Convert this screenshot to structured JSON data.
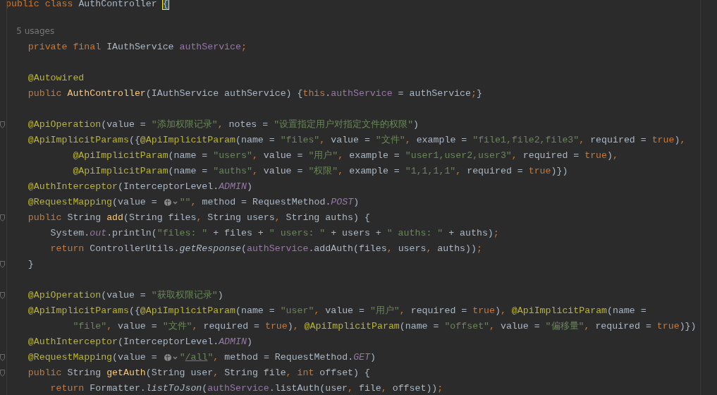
{
  "editor": {
    "lines": [
      {
        "kind": "code",
        "fold": false,
        "tokens": [
          {
            "t": "public ",
            "kind": "kw"
          },
          {
            "t": "class ",
            "kind": "kw"
          },
          {
            "t": "AuthController ",
            "kind": "plain"
          },
          {
            "t": "{",
            "kind": "match"
          }
        ]
      },
      {
        "kind": "blank",
        "fold": false
      },
      {
        "kind": "hint",
        "fold": false,
        "tokens": [
          {
            "t": "    5 usages",
            "kind": "hint"
          }
        ]
      },
      {
        "kind": "code",
        "fold": false,
        "tokens": [
          {
            "t": "    private final ",
            "kind": "kw"
          },
          {
            "t": "IAuthService ",
            "kind": "plain"
          },
          {
            "t": "authService",
            "kind": "field"
          },
          {
            "t": ";",
            "kind": "kw"
          }
        ]
      },
      {
        "kind": "blank",
        "fold": false
      },
      {
        "kind": "code",
        "fold": false,
        "tokens": [
          {
            "t": "    @Autowired",
            "kind": "ann"
          }
        ]
      },
      {
        "kind": "code",
        "fold": false,
        "tokens": [
          {
            "t": "    public ",
            "kind": "kw"
          },
          {
            "t": "AuthController",
            "kind": "method"
          },
          {
            "t": "(IAuthService authService) {",
            "kind": "plain"
          },
          {
            "t": "this",
            "kind": "kw"
          },
          {
            "t": ".",
            "kind": "plain"
          },
          {
            "t": "authService",
            "kind": "field"
          },
          {
            "t": " = authService",
            "kind": "plain"
          },
          {
            "t": ";",
            "kind": "kw"
          },
          {
            "t": "}",
            "kind": "plain"
          }
        ]
      },
      {
        "kind": "blank",
        "fold": false
      },
      {
        "kind": "code",
        "fold": true,
        "tokens": [
          {
            "t": "    @ApiOperation",
            "kind": "ann"
          },
          {
            "t": "(value = ",
            "kind": "plain"
          },
          {
            "t": "\"添加权限记录\"",
            "kind": "str"
          },
          {
            "t": ", ",
            "kind": "kw"
          },
          {
            "t": "notes = ",
            "kind": "plain"
          },
          {
            "t": "\"设置指定用户对指定文件的权限\"",
            "kind": "str"
          },
          {
            "t": ")",
            "kind": "plain"
          }
        ]
      },
      {
        "kind": "code",
        "fold": false,
        "tokens": [
          {
            "t": "    @ApiImplicitParams",
            "kind": "ann"
          },
          {
            "t": "({",
            "kind": "plain"
          },
          {
            "t": "@ApiImplicitParam",
            "kind": "ann"
          },
          {
            "t": "(name = ",
            "kind": "plain"
          },
          {
            "t": "\"files\"",
            "kind": "str"
          },
          {
            "t": ", ",
            "kind": "kw"
          },
          {
            "t": "value = ",
            "kind": "plain"
          },
          {
            "t": "\"文件\"",
            "kind": "str"
          },
          {
            "t": ", ",
            "kind": "kw"
          },
          {
            "t": "example = ",
            "kind": "plain"
          },
          {
            "t": "\"file1,file2,file3\"",
            "kind": "str"
          },
          {
            "t": ", ",
            "kind": "kw"
          },
          {
            "t": "required = ",
            "kind": "plain"
          },
          {
            "t": "true",
            "kind": "kw"
          },
          {
            "t": ")",
            "kind": "plain"
          },
          {
            "t": ",",
            "kind": "kw"
          }
        ]
      },
      {
        "kind": "code",
        "fold": false,
        "tokens": [
          {
            "t": "            @ApiImplicitParam",
            "kind": "ann"
          },
          {
            "t": "(name = ",
            "kind": "plain"
          },
          {
            "t": "\"users\"",
            "kind": "str"
          },
          {
            "t": ", ",
            "kind": "kw"
          },
          {
            "t": "value = ",
            "kind": "plain"
          },
          {
            "t": "\"用户\"",
            "kind": "str"
          },
          {
            "t": ", ",
            "kind": "kw"
          },
          {
            "t": "example = ",
            "kind": "plain"
          },
          {
            "t": "\"user1,user2,user3\"",
            "kind": "str"
          },
          {
            "t": ", ",
            "kind": "kw"
          },
          {
            "t": "required = ",
            "kind": "plain"
          },
          {
            "t": "true",
            "kind": "kw"
          },
          {
            "t": ")",
            "kind": "plain"
          },
          {
            "t": ",",
            "kind": "kw"
          }
        ]
      },
      {
        "kind": "code",
        "fold": false,
        "tokens": [
          {
            "t": "            @ApiImplicitParam",
            "kind": "ann"
          },
          {
            "t": "(name = ",
            "kind": "plain"
          },
          {
            "t": "\"auths\"",
            "kind": "str"
          },
          {
            "t": ", ",
            "kind": "kw"
          },
          {
            "t": "value = ",
            "kind": "plain"
          },
          {
            "t": "\"权限\"",
            "kind": "str"
          },
          {
            "t": ", ",
            "kind": "kw"
          },
          {
            "t": "example = ",
            "kind": "plain"
          },
          {
            "t": "\"1,1,1,1\"",
            "kind": "str"
          },
          {
            "t": ", ",
            "kind": "kw"
          },
          {
            "t": "required = ",
            "kind": "plain"
          },
          {
            "t": "true",
            "kind": "kw"
          },
          {
            "t": ")})",
            "kind": "plain"
          }
        ]
      },
      {
        "kind": "code",
        "fold": false,
        "tokens": [
          {
            "t": "    @AuthInterceptor",
            "kind": "ann"
          },
          {
            "t": "(InterceptorLevel.",
            "kind": "plain"
          },
          {
            "t": "ADMIN",
            "kind": "static"
          },
          {
            "t": ")",
            "kind": "plain"
          }
        ]
      },
      {
        "kind": "code",
        "fold": false,
        "tokens": [
          {
            "t": "    @RequestMapping",
            "kind": "ann"
          },
          {
            "t": "(value = ",
            "kind": "plain"
          },
          {
            "kind": "globe"
          },
          {
            "t": "\"\"",
            "kind": "str"
          },
          {
            "t": ", ",
            "kind": "kw"
          },
          {
            "t": "method = RequestMethod.",
            "kind": "plain"
          },
          {
            "t": "POST",
            "kind": "static"
          },
          {
            "t": ")",
            "kind": "plain"
          }
        ]
      },
      {
        "kind": "code",
        "fold": true,
        "tokens": [
          {
            "t": "    public ",
            "kind": "kw"
          },
          {
            "t": "String ",
            "kind": "plain"
          },
          {
            "t": "add",
            "kind": "method"
          },
          {
            "t": "(String files",
            "kind": "plain"
          },
          {
            "t": ", ",
            "kind": "kw"
          },
          {
            "t": "String users",
            "kind": "plain"
          },
          {
            "t": ", ",
            "kind": "kw"
          },
          {
            "t": "String auths) {",
            "kind": "plain"
          }
        ]
      },
      {
        "kind": "code",
        "fold": false,
        "tokens": [
          {
            "t": "        System.",
            "kind": "plain"
          },
          {
            "t": "out",
            "kind": "static"
          },
          {
            "t": ".println(",
            "kind": "plain"
          },
          {
            "t": "\"files: \"",
            "kind": "str"
          },
          {
            "t": " + files + ",
            "kind": "plain"
          },
          {
            "t": "\" users: \"",
            "kind": "str"
          },
          {
            "t": " + users + ",
            "kind": "plain"
          },
          {
            "t": "\" auths: \"",
            "kind": "str"
          },
          {
            "t": " + auths)",
            "kind": "plain"
          },
          {
            "t": ";",
            "kind": "kw"
          }
        ]
      },
      {
        "kind": "code",
        "fold": false,
        "tokens": [
          {
            "t": "        return ",
            "kind": "kw"
          },
          {
            "t": "ControllerUtils.",
            "kind": "plain"
          },
          {
            "t": "getResponse",
            "kind": "italic"
          },
          {
            "t": "(",
            "kind": "plain"
          },
          {
            "t": "authService",
            "kind": "field"
          },
          {
            "t": ".addAuth(files",
            "kind": "plain"
          },
          {
            "t": ", ",
            "kind": "kw"
          },
          {
            "t": "users",
            "kind": "plain"
          },
          {
            "t": ", ",
            "kind": "kw"
          },
          {
            "t": "auths))",
            "kind": "plain"
          },
          {
            "t": ";",
            "kind": "kw"
          }
        ]
      },
      {
        "kind": "code",
        "fold": true,
        "tokens": [
          {
            "t": "    }",
            "kind": "plain"
          }
        ]
      },
      {
        "kind": "blank",
        "fold": false
      },
      {
        "kind": "code",
        "fold": true,
        "tokens": [
          {
            "t": "    @ApiOperation",
            "kind": "ann"
          },
          {
            "t": "(value = ",
            "kind": "plain"
          },
          {
            "t": "\"获取权限记录\"",
            "kind": "str"
          },
          {
            "t": ")",
            "kind": "plain"
          }
        ]
      },
      {
        "kind": "code",
        "fold": false,
        "tokens": [
          {
            "t": "    @ApiImplicitParams",
            "kind": "ann"
          },
          {
            "t": "({",
            "kind": "plain"
          },
          {
            "t": "@ApiImplicitParam",
            "kind": "ann"
          },
          {
            "t": "(name = ",
            "kind": "plain"
          },
          {
            "t": "\"user\"",
            "kind": "str"
          },
          {
            "t": ", ",
            "kind": "kw"
          },
          {
            "t": "value = ",
            "kind": "plain"
          },
          {
            "t": "\"用户\"",
            "kind": "str"
          },
          {
            "t": ", ",
            "kind": "kw"
          },
          {
            "t": "required = ",
            "kind": "plain"
          },
          {
            "t": "true",
            "kind": "kw"
          },
          {
            "t": ")",
            "kind": "plain"
          },
          {
            "t": ", ",
            "kind": "kw"
          },
          {
            "t": "@ApiImplicitParam",
            "kind": "ann"
          },
          {
            "t": "(name =",
            "kind": "plain"
          }
        ]
      },
      {
        "kind": "code",
        "fold": false,
        "tokens": [
          {
            "t": "            \"file\"",
            "kind": "str"
          },
          {
            "t": ", ",
            "kind": "kw"
          },
          {
            "t": "value = ",
            "kind": "plain"
          },
          {
            "t": "\"文件\"",
            "kind": "str"
          },
          {
            "t": ", ",
            "kind": "kw"
          },
          {
            "t": "required = ",
            "kind": "plain"
          },
          {
            "t": "true",
            "kind": "kw"
          },
          {
            "t": ")",
            "kind": "plain"
          },
          {
            "t": ", ",
            "kind": "kw"
          },
          {
            "t": "@ApiImplicitParam",
            "kind": "ann"
          },
          {
            "t": "(name = ",
            "kind": "plain"
          },
          {
            "t": "\"offset\"",
            "kind": "str"
          },
          {
            "t": ", ",
            "kind": "kw"
          },
          {
            "t": "value = ",
            "kind": "plain"
          },
          {
            "t": "\"偏移量\"",
            "kind": "str"
          },
          {
            "t": ", ",
            "kind": "kw"
          },
          {
            "t": "required = ",
            "kind": "plain"
          },
          {
            "t": "true",
            "kind": "kw"
          },
          {
            "t": ")})",
            "kind": "plain"
          }
        ]
      },
      {
        "kind": "code",
        "fold": false,
        "tokens": [
          {
            "t": "    @AuthInterceptor",
            "kind": "ann"
          },
          {
            "t": "(InterceptorLevel.",
            "kind": "plain"
          },
          {
            "t": "ADMIN",
            "kind": "static"
          },
          {
            "t": ")",
            "kind": "plain"
          }
        ]
      },
      {
        "kind": "code",
        "fold": true,
        "tokens": [
          {
            "t": "    @RequestMapping",
            "kind": "ann"
          },
          {
            "t": "(value = ",
            "kind": "plain"
          },
          {
            "kind": "globe"
          },
          {
            "t": "\"",
            "kind": "str"
          },
          {
            "t": "/all",
            "kind": "url"
          },
          {
            "t": "\"",
            "kind": "str"
          },
          {
            "t": ", ",
            "kind": "kw"
          },
          {
            "t": "method = RequestMethod.",
            "kind": "plain"
          },
          {
            "t": "GET",
            "kind": "static"
          },
          {
            "t": ")",
            "kind": "plain"
          }
        ]
      },
      {
        "kind": "code",
        "fold": true,
        "tokens": [
          {
            "t": "    public ",
            "kind": "kw"
          },
          {
            "t": "String ",
            "kind": "plain"
          },
          {
            "t": "getAuth",
            "kind": "method"
          },
          {
            "t": "(String user",
            "kind": "plain"
          },
          {
            "t": ", ",
            "kind": "kw"
          },
          {
            "t": "String file",
            "kind": "plain"
          },
          {
            "t": ", ",
            "kind": "kw"
          },
          {
            "t": "int ",
            "kind": "kw"
          },
          {
            "t": "offset) {",
            "kind": "plain"
          }
        ]
      },
      {
        "kind": "code",
        "fold": false,
        "tokens": [
          {
            "t": "        return ",
            "kind": "kw"
          },
          {
            "t": "Formatter.",
            "kind": "plain"
          },
          {
            "t": "listToJson",
            "kind": "italic"
          },
          {
            "t": "(",
            "kind": "plain"
          },
          {
            "t": "authService",
            "kind": "field"
          },
          {
            "t": ".listAuth(user",
            "kind": "plain"
          },
          {
            "t": ", ",
            "kind": "kw"
          },
          {
            "t": "file",
            "kind": "plain"
          },
          {
            "t": ", ",
            "kind": "kw"
          },
          {
            "t": "offset))",
            "kind": "plain"
          },
          {
            "t": ";",
            "kind": "kw"
          }
        ]
      }
    ]
  }
}
